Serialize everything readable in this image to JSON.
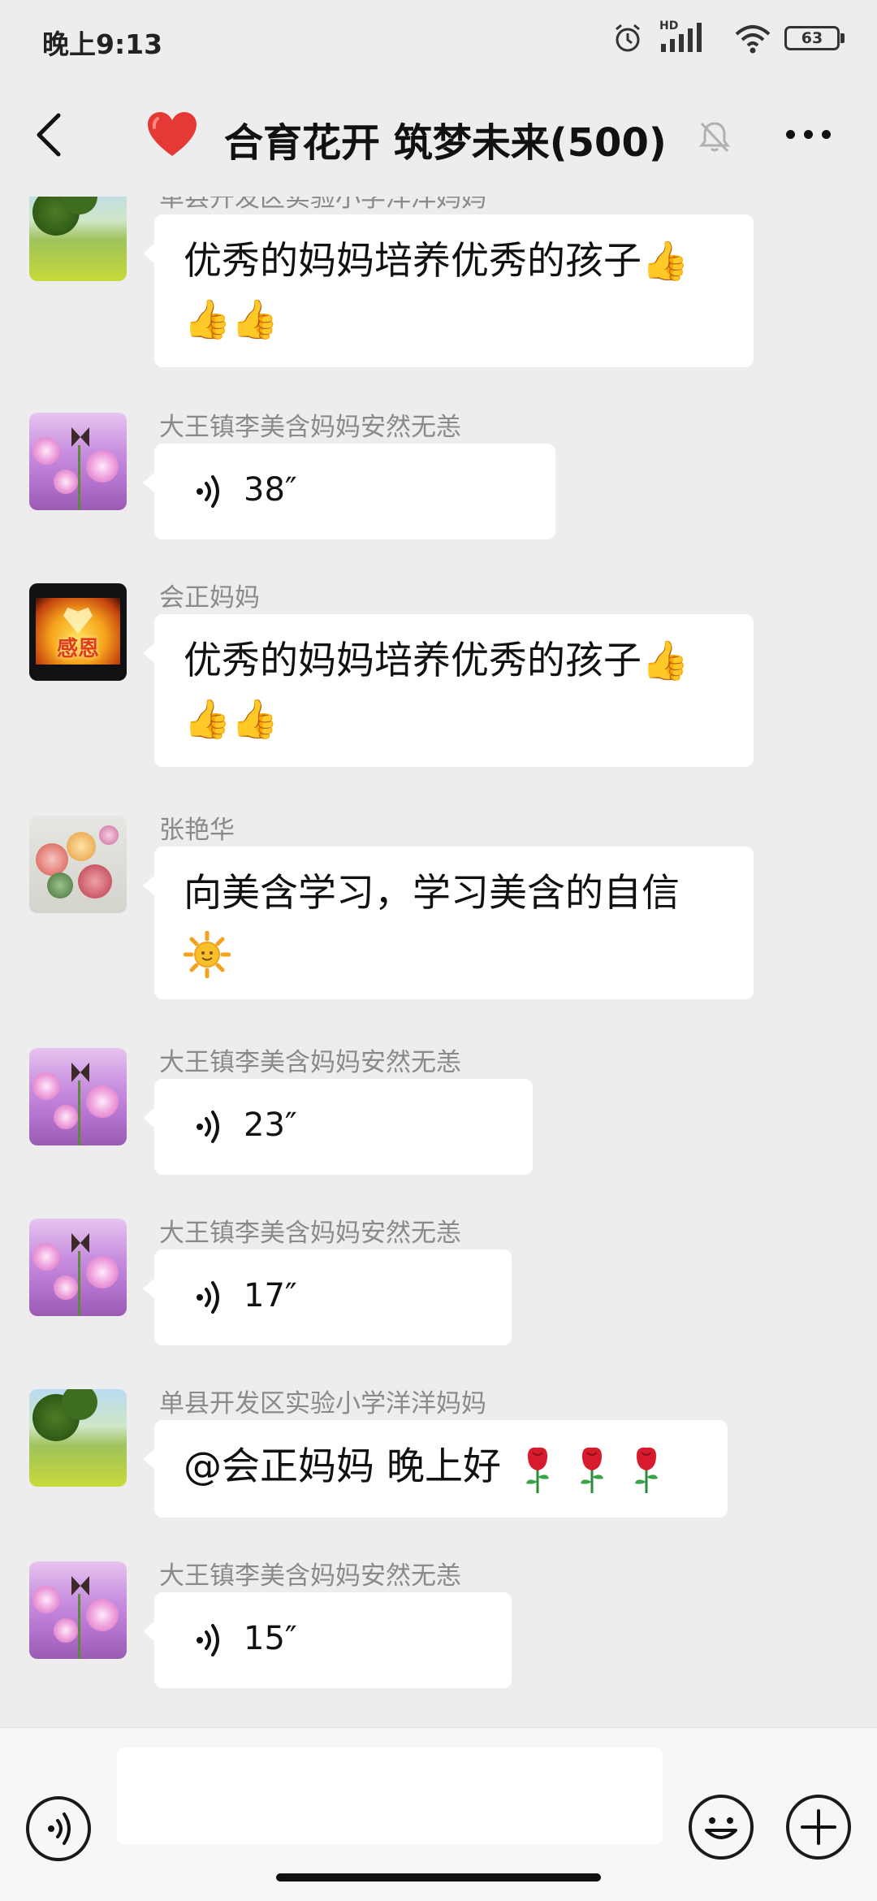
{
  "status_bar": {
    "time": "晚上9:13",
    "hd_label": "HD",
    "battery": "63"
  },
  "header": {
    "title": "合育花开 筑梦未来(500)",
    "back_icon": "back-chevron-icon",
    "title_icon": "red-heart-icon",
    "mute_icon": "bell-muted-icon",
    "more_icon": "more-dots-icon"
  },
  "messages": [
    {
      "sender": "单县开发区实验小学洋洋妈妈",
      "type": "text",
      "text": "优秀的妈妈培养优秀的孩子👍👍👍",
      "avatar": "green-field"
    },
    {
      "sender": "大王镇李美含妈妈安然无恙",
      "type": "voice",
      "duration": "38″",
      "avatar": "pink-cosmos"
    },
    {
      "sender": "会正妈妈",
      "type": "text",
      "text": "优秀的妈妈培养优秀的孩子👍👍👍",
      "avatar": "sunset-ganen",
      "avatar_text": "感恩"
    },
    {
      "sender": "张艳华",
      "type": "text",
      "text": "向美含学习，学习美含的自信",
      "emoji": "sun-face-emoji",
      "avatar": "peony-painting"
    },
    {
      "sender": "大王镇李美含妈妈安然无恙",
      "type": "voice",
      "duration": "23″",
      "avatar": "pink-cosmos"
    },
    {
      "sender": "大王镇李美含妈妈安然无恙",
      "type": "voice",
      "duration": "17″",
      "avatar": "pink-cosmos"
    },
    {
      "sender": "单县开发区实验小学洋洋妈妈",
      "type": "text",
      "text": "@会正妈妈  晚上好",
      "emoji": "rose-emoji",
      "emoji_count": 3,
      "avatar": "green-field"
    },
    {
      "sender": "大王镇李美含妈妈安然无恙",
      "type": "voice",
      "duration": "15″",
      "avatar": "pink-cosmos"
    }
  ],
  "input_bar": {
    "placeholder": "",
    "voice_icon": "voice-mode-icon",
    "emoji_icon": "emoji-smile-icon",
    "plus_icon": "plus-icon"
  },
  "colors": {
    "background": "#ededed",
    "bubble": "#ffffff",
    "sender_name": "#8a8a8a",
    "heart": "#e53935"
  }
}
